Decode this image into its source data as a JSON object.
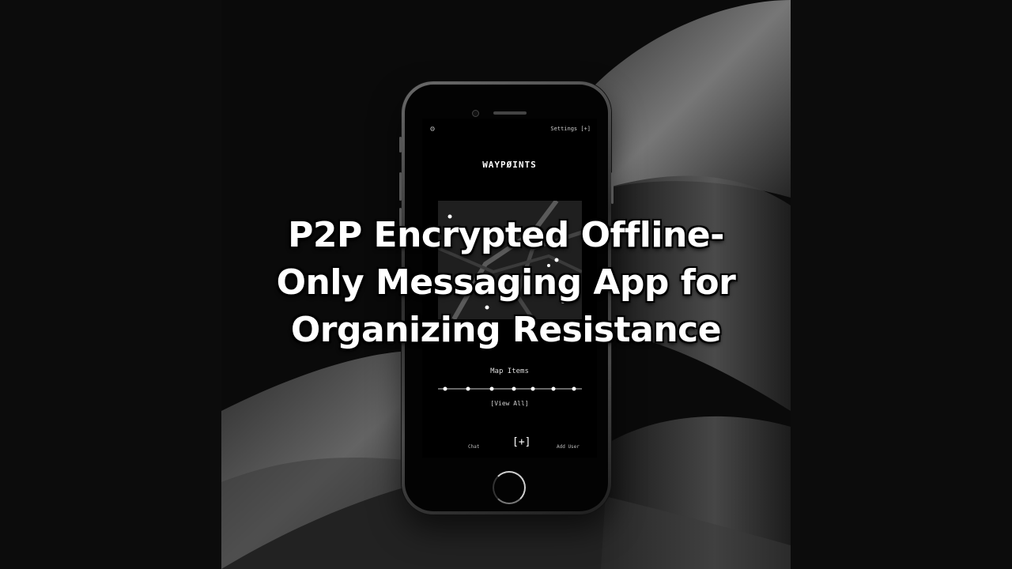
{
  "headline": {
    "line1": "P2P Encrypted Offline-",
    "line2": "Only Messaging App for",
    "line3": "Organizing Resistance"
  },
  "app": {
    "settings_link": "Settings [+]",
    "title": "WAYPØINTS",
    "map_items_label": "Map Items",
    "view_all": "[View All]",
    "nav": {
      "chat": "Chat",
      "add": "[+]",
      "add_user": "Add User"
    }
  },
  "icons": {
    "settings": "gear-icon",
    "camera": "camera-icon",
    "home": "home-button"
  },
  "colors": {
    "background": "#0a0a0a",
    "screen": "#000000",
    "text": "#ffffff"
  }
}
